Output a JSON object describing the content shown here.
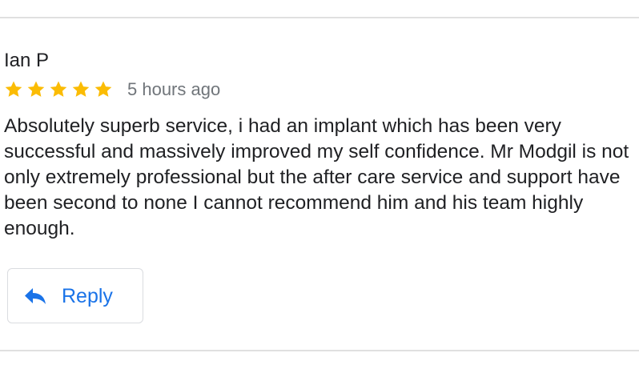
{
  "review": {
    "reviewer_name": "Ian P",
    "rating": 5,
    "rating_max": 5,
    "star_icon": "star-icon",
    "timestamp": "5 hours ago",
    "text": "Absolutely superb service, i had an implant which has been very successful and massively improved my self confidence. Mr Modgil is not only extremely professional but the after care service and support have been second to none I cannot recommend him and his team highly enough."
  },
  "actions": {
    "reply_label": "Reply",
    "reply_icon": "reply-icon"
  },
  "colors": {
    "star": "#fbbc04",
    "accent": "#1a73e8",
    "muted_text": "#70757a",
    "divider": "#e0e0e0"
  }
}
